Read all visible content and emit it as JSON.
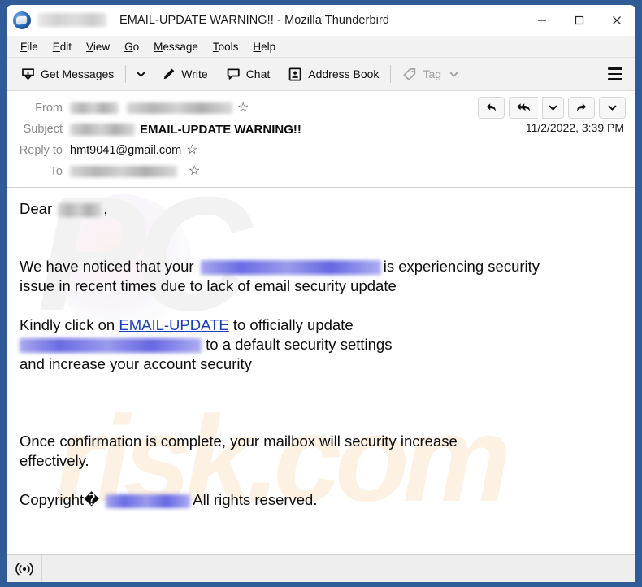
{
  "window": {
    "title": "EMAIL-UPDATE WARNING!! - Mozilla Thunderbird",
    "app_name": "Mozilla Thunderbird",
    "logo_icon": "thunderbird-logo-icon",
    "redacted_title_prefix": "[redacted]",
    "controls": {
      "minimize": "minimize-icon",
      "maximize": "maximize-icon",
      "close": "close-icon"
    },
    "frame_color": "#2f5c97"
  },
  "menubar": {
    "items": [
      {
        "label": "File",
        "accel": "F",
        "rest": "ile"
      },
      {
        "label": "Edit",
        "accel": "E",
        "rest": "dit"
      },
      {
        "label": "View",
        "accel": "V",
        "rest": "iew"
      },
      {
        "label": "Go",
        "accel": "G",
        "rest": "o"
      },
      {
        "label": "Message",
        "accel": "M",
        "rest": "essage"
      },
      {
        "label": "Tools",
        "accel": "T",
        "rest": "ools"
      },
      {
        "label": "Help",
        "accel": "H",
        "rest": "elp"
      }
    ]
  },
  "toolbar": {
    "get_messages_label": "Get Messages",
    "get_messages_icon": "download-inbox-icon",
    "get_messages_caret": "chevron-down-icon",
    "write_label": "Write",
    "write_icon": "pencil-icon",
    "chat_label": "Chat",
    "chat_icon": "speech-bubble-icon",
    "address_book_label": "Address Book",
    "address_book_icon": "address-book-icon",
    "tag_label": "Tag",
    "tag_icon": "tag-icon",
    "tag_caret": "chevron-down-icon",
    "tag_disabled": true,
    "app_menu_icon": "hamburger-menu-icon"
  },
  "message_header": {
    "fields": [
      {
        "label": "From",
        "value": "",
        "redacted": true,
        "redaction_style": "grey",
        "star": "☆"
      },
      {
        "label": "Subject",
        "value": "EMAIL-UPDATE WARNING!!",
        "redacted": true,
        "redaction_style": "grey",
        "star": ""
      },
      {
        "label": "Reply to",
        "value": "hmt9041@gmail.com",
        "redacted": false,
        "redaction_style": "",
        "star": "☆"
      },
      {
        "label": "To",
        "value": "",
        "redacted": true,
        "redaction_style": "grey",
        "star": "☆"
      }
    ],
    "from_label": "From",
    "subject_label": "Subject",
    "subject_value": "EMAIL-UPDATE WARNING!!",
    "reply_to_label": "Reply to",
    "reply_to_value": "hmt9041@gmail.com",
    "to_label": "To",
    "date": "11/2/2022, 3:39 PM",
    "star_glyph": "☆",
    "actions": [
      {
        "name": "reply-button",
        "icon": "reply-arrow-icon"
      },
      {
        "name": "reply-all-button",
        "icon": "reply-all-arrow-icon"
      },
      {
        "name": "reply-all-dropdown-button",
        "icon": "chevron-down-icon"
      },
      {
        "name": "forward-button",
        "icon": "forward-arrow-icon"
      },
      {
        "name": "more-actions-dropdown-button",
        "icon": "chevron-down-icon"
      }
    ]
  },
  "body": {
    "greeting_prefix": "Dear",
    "greeting_suffix": ",",
    "para1_part1": "We have noticed that your",
    "para1_part2": "is experiencing security",
    "para1_line2": "issue in recent times due to lack of email security update",
    "para2_part1": "Kindly click on",
    "para2_link": "EMAIL-UPDATE",
    "para2_part2": "to officially update",
    "para2_line2_suffix": "to a default security settings",
    "para2_line3": "and increase your account security",
    "para3_line1": "Once confirmation is complete, your mailbox will security increase",
    "para3_line2": "effectively.",
    "para4_prefix": "Copyright�",
    "para4_suffix": "All rights reserved.",
    "link_color": "#1b3fbb",
    "watermark_top": "PC",
    "watermark_bottom": "risk.com"
  },
  "statusbar": {
    "connection_icon": "wireless-online-icon",
    "status_text": ""
  }
}
